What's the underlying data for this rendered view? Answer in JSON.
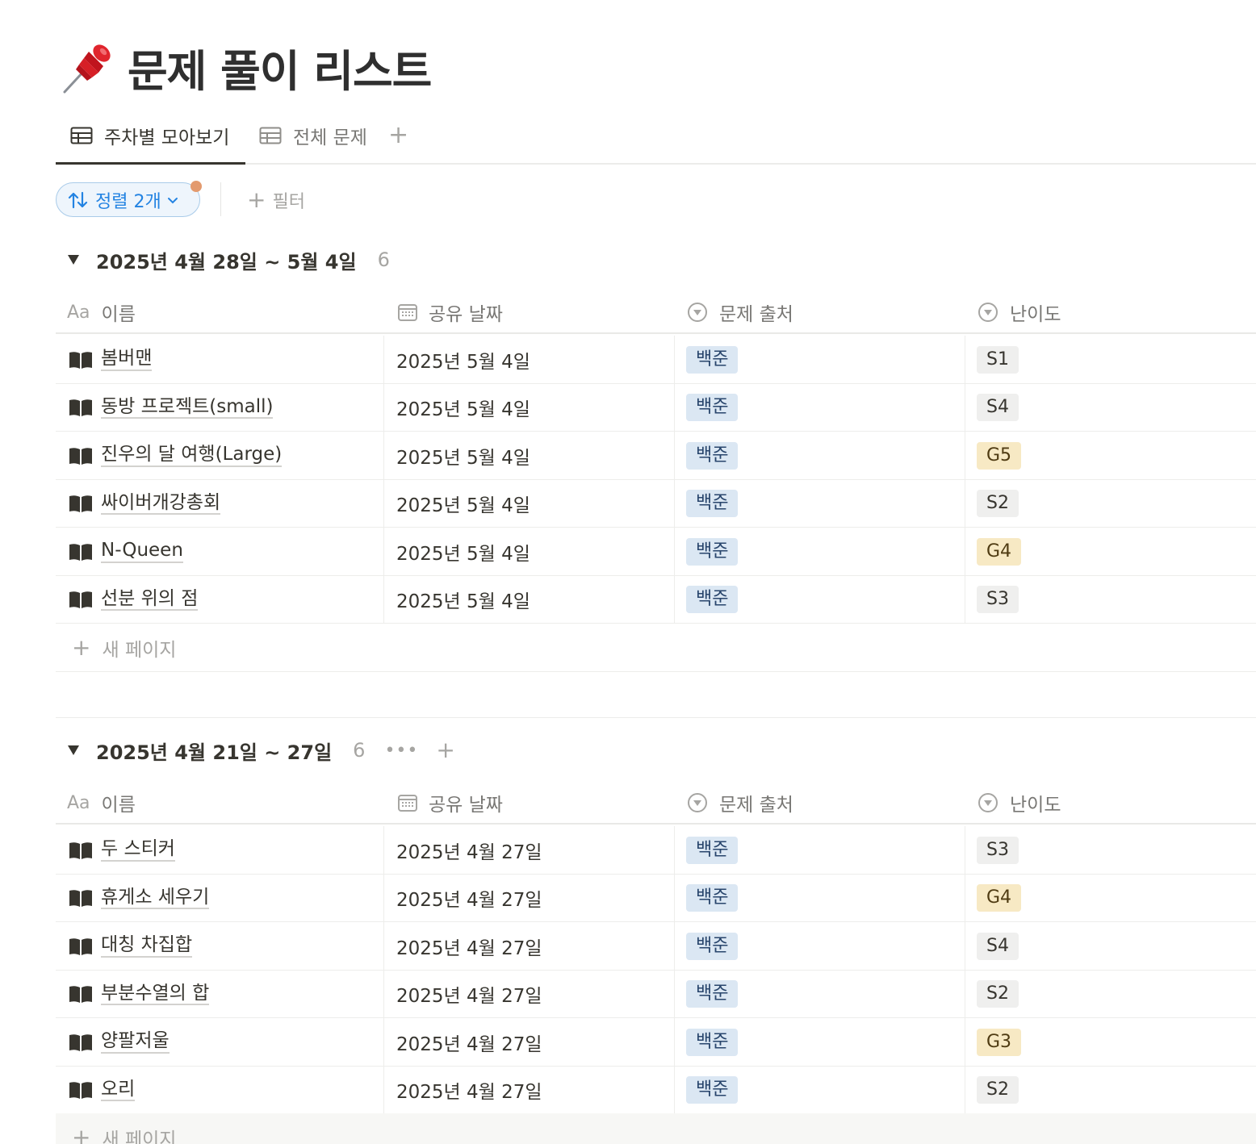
{
  "page": {
    "title": "문제 풀이 리스트",
    "icon": "pushpin-icon"
  },
  "tabs": [
    {
      "label": "주차별 모아보기",
      "icon": "table-icon",
      "active": true
    },
    {
      "label": "전체 문제",
      "icon": "table-icon",
      "active": false
    }
  ],
  "toolbar": {
    "sort_label": "정렬 2개",
    "filter_label": "필터",
    "accent": "#2383e2"
  },
  "columns": {
    "name": "이름",
    "name_prefix": "Aa",
    "date": "공유 날짜",
    "source": "문제 출처",
    "level": "난이도"
  },
  "colors": {
    "tag_blue": "#dbe7f3",
    "tag_gold": "#f7e9c4",
    "tag_gray": "#efefee"
  },
  "groups": [
    {
      "title": "2025년 4월 28일 ~ 5월 4일",
      "count": "6",
      "rows": [
        {
          "name": "봄버맨",
          "date": "2025년 5월 4일",
          "source": "백준",
          "level": "S1"
        },
        {
          "name": "동방 프로젝트(small)",
          "date": "2025년 5월 4일",
          "source": "백준",
          "level": "S4"
        },
        {
          "name": "진우의 달 여행(Large)",
          "date": "2025년 5월 4일",
          "source": "백준",
          "level": "G5"
        },
        {
          "name": "싸이버개강총회",
          "date": "2025년 5월 4일",
          "source": "백준",
          "level": "S2"
        },
        {
          "name": "N-Queen",
          "date": "2025년 5월 4일",
          "source": "백준",
          "level": "G4"
        },
        {
          "name": "선분 위의 점",
          "date": "2025년 5월 4일",
          "source": "백준",
          "level": "S3"
        }
      ],
      "new_page": "새 페이지"
    },
    {
      "title": "2025년 4월 21일 ~ 27일",
      "count": "6",
      "rows": [
        {
          "name": "두 스티커",
          "date": "2025년 4월 27일",
          "source": "백준",
          "level": "S3"
        },
        {
          "name": "휴게소 세우기",
          "date": "2025년 4월 27일",
          "source": "백준",
          "level": "G4"
        },
        {
          "name": "대칭 차집합",
          "date": "2025년 4월 27일",
          "source": "백준",
          "level": "S4"
        },
        {
          "name": "부분수열의 합",
          "date": "2025년 4월 27일",
          "source": "백준",
          "level": "S2"
        },
        {
          "name": "양팔저울",
          "date": "2025년 4월 27일",
          "source": "백준",
          "level": "G3"
        },
        {
          "name": "오리",
          "date": "2025년 4월 27일",
          "source": "백준",
          "level": "S2"
        }
      ],
      "new_page": "새 페이지"
    }
  ]
}
